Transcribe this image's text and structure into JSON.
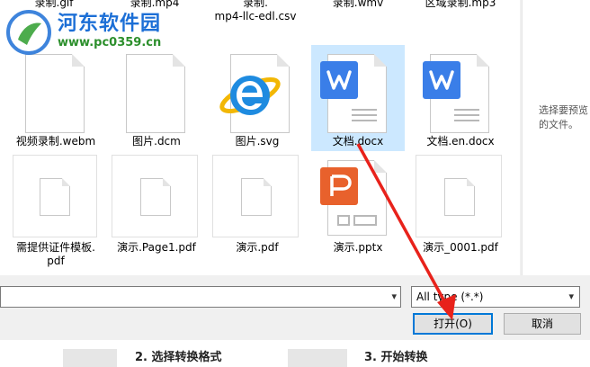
{
  "watermark": {
    "title": "河东软件园",
    "url": "www.pc0359.cn"
  },
  "top_row_labels": [
    "录制.gif",
    "录制.mp4",
    "录制.",
    "mp4-llc-edl.csv",
    "录制.wmv",
    "区域录制.mp3"
  ],
  "files": [
    {
      "name": "视频录制.webm",
      "icon": "blank-file-icon"
    },
    {
      "name": "图片.dcm",
      "icon": "blank-file-icon"
    },
    {
      "name": "图片.svg",
      "icon": "ie-browser-icon"
    },
    {
      "name": "文档.docx",
      "icon": "wps-writer-icon",
      "selected": true
    },
    {
      "name": "文档.en.docx",
      "icon": "wps-writer-icon"
    },
    {
      "name_line1": "需提供证件模板.",
      "name_line2": "pdf",
      "icon": "blank-file-icon"
    },
    {
      "name": "演示.Page1.pdf",
      "icon": "blank-file-icon"
    },
    {
      "name": "演示.pdf",
      "icon": "blank-file-icon"
    },
    {
      "name": "演示.pptx",
      "icon": "wps-presentation-icon"
    },
    {
      "name": "演示_0001.pdf",
      "icon": "blank-file-icon"
    }
  ],
  "preview": {
    "line1": "选择要预览",
    "line2": "的文件。"
  },
  "file_type": {
    "value": "All type (*.*)"
  },
  "buttons": {
    "open": "打开(O)",
    "cancel": "取消"
  },
  "steps": {
    "step2": "2. 选择转换格式",
    "step3": "3. 开始转换"
  },
  "colors": {
    "selected_bg": "#cce8ff",
    "accent": "#0078d7",
    "arrow": "#e8221b",
    "wps_blue": "#3a7ee8",
    "wps_orange": "#e8612c"
  }
}
